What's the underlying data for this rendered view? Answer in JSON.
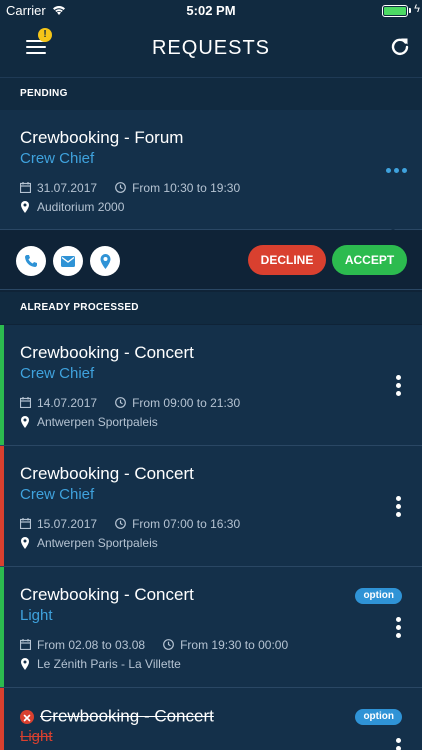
{
  "status_bar": {
    "carrier": "Carrier",
    "time": "5:02 PM"
  },
  "header": {
    "title": "REQUESTS",
    "alert_badge": "!"
  },
  "sections": {
    "pending": "PENDING",
    "processed": "ALREADY PROCESSED"
  },
  "pending_card": {
    "title": "Crewbooking - Forum",
    "role": "Crew Chief",
    "date": "31.07.2017",
    "time": "From 10:30 to 19:30",
    "location": "Auditorium 2000"
  },
  "actions": {
    "decline": "DECLINE",
    "accept": "ACCEPT"
  },
  "processed": [
    {
      "title": "Crewbooking - Concert",
      "role": "Crew Chief",
      "date": "14.07.2017",
      "time": "From 09:00 to 21:30",
      "location": "Antwerpen Sportpaleis",
      "status_color": "#2cbb4f"
    },
    {
      "title": "Crewbooking - Concert",
      "role": "Crew Chief",
      "date": "15.07.2017",
      "time": "From 07:00 to 16:30",
      "location": "Antwerpen Sportpaleis",
      "status_color": "#d9402f"
    },
    {
      "title": "Crewbooking - Concert",
      "role": "Light",
      "date": "From 02.08 to 03.08",
      "time": "From 19:30 to 00:00",
      "location": "Le Zénith Paris - La Villette",
      "badge": "option",
      "status_color": "#2cbb4f"
    },
    {
      "title": "Crewbooking - Concert",
      "role": "Light",
      "badge": "option",
      "status_color": "#d9402f",
      "cancelled": true
    }
  ],
  "colors": {
    "accent_blue": "#3fa2dd",
    "decline": "#d9402f",
    "accept": "#2cbb4f",
    "background": "#0f2337"
  }
}
